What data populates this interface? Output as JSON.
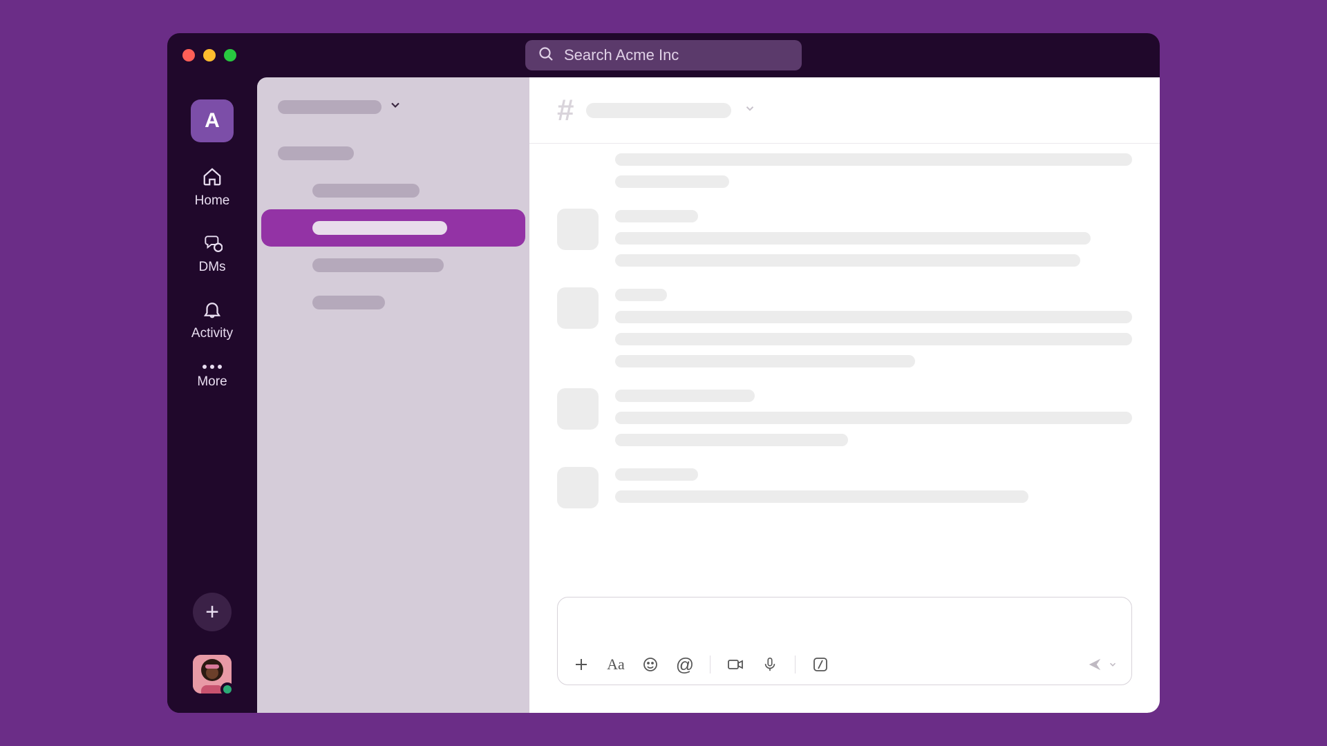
{
  "window": {
    "traffic_lights": {
      "red": "close",
      "yellow": "minimize",
      "green": "zoom"
    }
  },
  "search": {
    "placeholder": "Search Acme Inc"
  },
  "workspace": {
    "initial": "A"
  },
  "rail": {
    "home": "Home",
    "dms": "DMs",
    "activity": "Activity",
    "more": "More"
  },
  "sidebar": {
    "workspace_name": "",
    "sections": [
      {
        "type": "section"
      },
      {
        "type": "child",
        "w": ""
      },
      {
        "type": "active"
      },
      {
        "type": "child",
        "w": "w1"
      },
      {
        "type": "child",
        "w": "w3"
      }
    ]
  },
  "channel": {
    "name": ""
  },
  "messages": [
    {
      "first": true,
      "line_widths": [
        100,
        22
      ]
    },
    {
      "line_widths": [
        16,
        92,
        90
      ]
    },
    {
      "line_widths": [
        10,
        100,
        100,
        58
      ]
    },
    {
      "line_widths": [
        27,
        100,
        45
      ]
    },
    {
      "line_widths": [
        16,
        80
      ]
    }
  ],
  "composer": {
    "icons": [
      "plus",
      "format",
      "emoji",
      "mention",
      "sep",
      "video",
      "audio",
      "sep",
      "slash"
    ],
    "send_label": ""
  },
  "user": {
    "presence": "active"
  }
}
